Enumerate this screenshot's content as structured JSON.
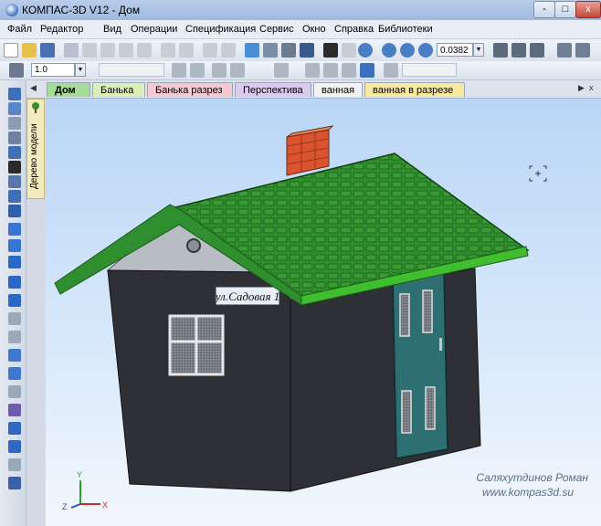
{
  "window": {
    "title": "КОМПАС-3D V12 - Дом",
    "buttons": [
      "-",
      "□",
      "x"
    ]
  },
  "menu": [
    {
      "label": "Файл"
    },
    {
      "label": "Редактор"
    },
    {
      "label": "Вид"
    },
    {
      "label": "Операции"
    },
    {
      "label": "Спецификация"
    },
    {
      "label": "Сервис"
    },
    {
      "label": "Окно"
    },
    {
      "label": "Справка"
    },
    {
      "label": "Библиотеки"
    }
  ],
  "toolbar": {
    "zoom_value": "0.0382",
    "step_value": "1.0"
  },
  "tree_panel": {
    "label": "Дерево модели"
  },
  "tabs": [
    {
      "label": "Дом",
      "color": "#a5dd96",
      "active": true
    },
    {
      "label": "Банька",
      "color": "#dbf0b8"
    },
    {
      "label": "Банька разрез",
      "color": "#f6c8d2"
    },
    {
      "label": "Перспектива",
      "color": "#ddc9f0"
    },
    {
      "label": "ванная",
      "color": "#f2f2f2"
    },
    {
      "label": "ванная в разрезе",
      "color": "#f7eaa0"
    }
  ],
  "model": {
    "street_sign": "ул.Садовая 1",
    "wall_color": "#2f3035",
    "roof_color": "#2f8f2f",
    "door_color": "#2e6f73",
    "chimney_color": "#d9532f"
  },
  "axes": {
    "x": "X",
    "y": "Y",
    "z": "Z"
  },
  "watermark": {
    "author": "Саляхутдинов Роман",
    "site": "www.kompas3d.su"
  }
}
